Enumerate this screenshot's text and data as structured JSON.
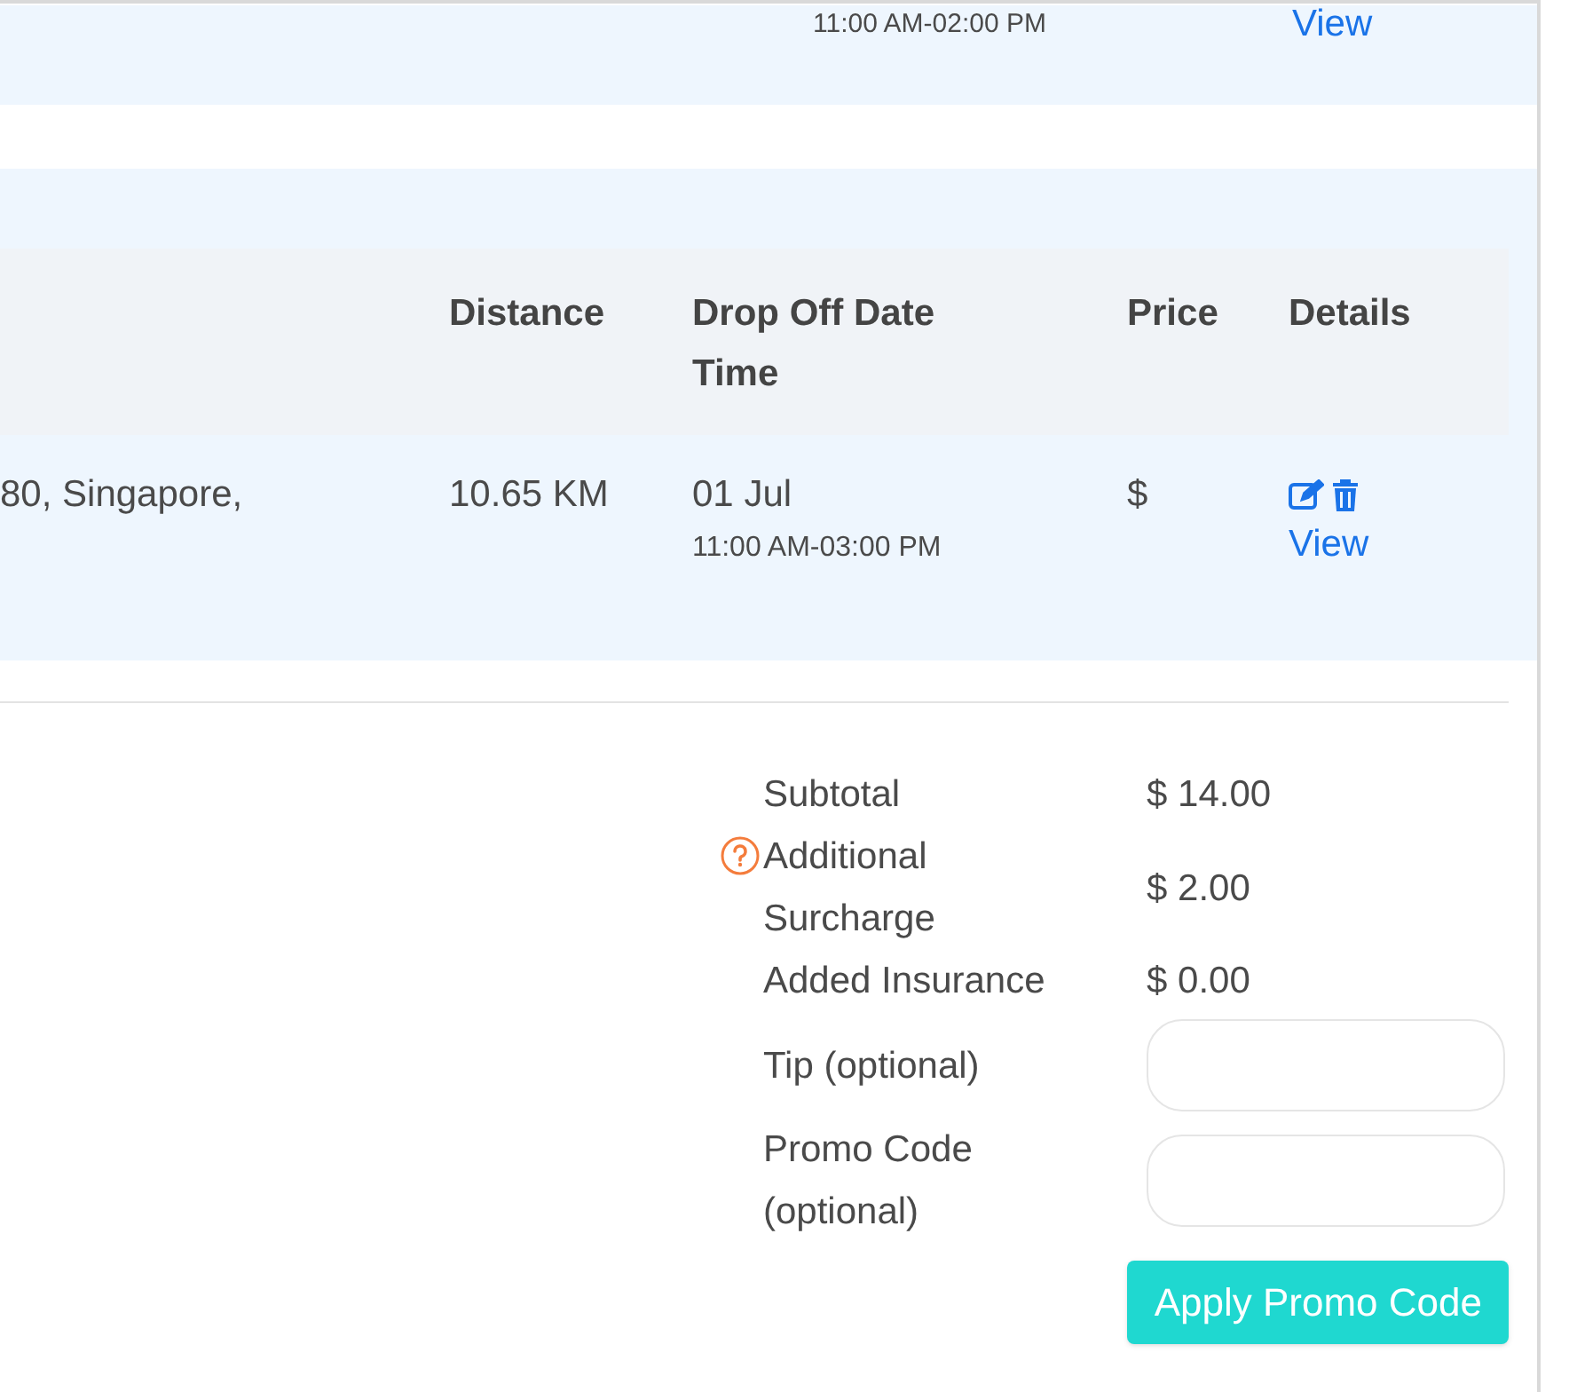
{
  "previous_row": {
    "time": "11:00 AM-02:00 PM",
    "link": "View"
  },
  "table": {
    "columns": [
      "Distance",
      "Drop Off Date Time",
      "Price",
      "Details"
    ],
    "rows": [
      {
        "address": "80, Singapore,",
        "distance": "10.65 KM",
        "date": "01 Jul",
        "time": "11:00 AM-03:00 PM",
        "price": "$",
        "link": "View"
      }
    ]
  },
  "summary": [
    {
      "kind": "amount",
      "label": "Subtotal",
      "value": "$ 14.00",
      "help": false
    },
    {
      "kind": "amount",
      "label": "Additional Surcharge",
      "value": "$ 2.00",
      "help": true
    },
    {
      "kind": "amount",
      "label": "Added Insurance",
      "value": "$ 0.00",
      "help": false
    },
    {
      "kind": "input",
      "label": "Tip (optional)"
    },
    {
      "kind": "input",
      "label": "Promo Code (optional)"
    }
  ],
  "apply_button": "Apply Promo Code"
}
